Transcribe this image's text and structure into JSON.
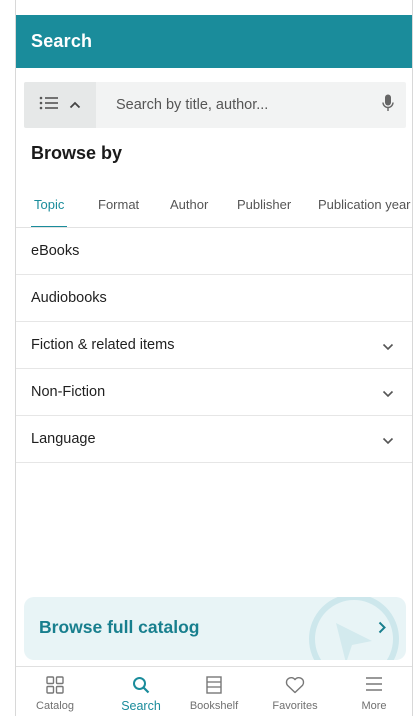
{
  "colors": {
    "accent": "#1a8c9b",
    "header_bg": "#1a8c9b",
    "catalog_card_bg": "#e8f4f6"
  },
  "header": {
    "title": "Search"
  },
  "search": {
    "placeholder": "Search by title, author...",
    "left_icons": [
      "list-icon",
      "chevron-up-icon"
    ],
    "right_icon": "microphone-icon"
  },
  "browse": {
    "title": "Browse by"
  },
  "tabs": [
    {
      "label": "Topic",
      "active": true
    },
    {
      "label": "Format",
      "active": false
    },
    {
      "label": "Author",
      "active": false
    },
    {
      "label": "Publisher",
      "active": false
    },
    {
      "label": "Publication year",
      "active": false
    }
  ],
  "topics": [
    {
      "label": "eBooks",
      "expandable": false
    },
    {
      "label": "Audiobooks",
      "expandable": false
    },
    {
      "label": "Fiction & related items",
      "expandable": true
    },
    {
      "label": "Non-Fiction",
      "expandable": true
    },
    {
      "label": "Language",
      "expandable": true
    }
  ],
  "catalog_card": {
    "label": "Browse full catalog",
    "icon": "chevron-right-icon"
  },
  "bottom_nav": [
    {
      "label": "Catalog",
      "icon": "grid-icon",
      "active": false
    },
    {
      "label": "Search",
      "icon": "search-icon",
      "active": true
    },
    {
      "label": "Bookshelf",
      "icon": "bookshelf-icon",
      "active": false
    },
    {
      "label": "Favorites",
      "icon": "heart-icon",
      "active": false
    },
    {
      "label": "More",
      "icon": "menu-icon",
      "active": false
    }
  ]
}
